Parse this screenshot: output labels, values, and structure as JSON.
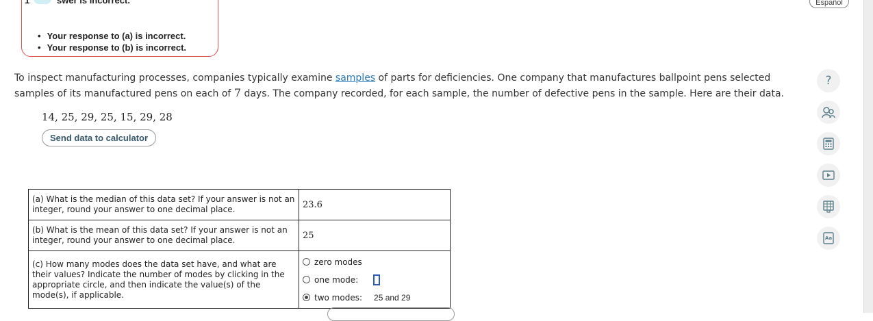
{
  "feedback": {
    "digit": "1",
    "title": "swer is incorrect.",
    "items": [
      "Your response to (a) is incorrect.",
      "Your response to (b) is incorrect."
    ]
  },
  "language_button": "Español",
  "problem": {
    "text_before_link": "To inspect manufacturing processes, companies typically examine ",
    "link": "samples",
    "text_after_link": " of parts for deficiencies. One company that manufactures ballpoint pens selected samples of its manufactured pens on each of ",
    "days": "7",
    "text_end": " days. The company recorded, for each sample, the number of defective pens in the sample. Here are their data."
  },
  "dataset": "14, 25, 29, 25, 15, 29, 28",
  "send_button": "Send data to calculator",
  "questions": {
    "a": {
      "text": "(a) What is the median of this data set? If your answer is not an integer, round your answer to one decimal place.",
      "answer": "23.6"
    },
    "b": {
      "text": "(b) What is the mean of this data set? If your answer is not an integer, round your answer to one decimal place.",
      "answer": "25"
    },
    "c": {
      "text": "(c) How many modes does the data set have, and what are their values? Indicate the number of modes by clicking in the appropriate circle, and then indicate the value(s) of the mode(s), if applicable.",
      "options": [
        "zero modes",
        "one mode:",
        "two modes:"
      ],
      "selected": "two modes:",
      "two_modes_value": "25 and 29"
    }
  },
  "tools": [
    "help-icon",
    "tutor-icon",
    "calculator-icon",
    "video-icon",
    "data-table-icon",
    "glossary-icon"
  ],
  "tool_glyphs": {
    "help": "?",
    "video": "▷",
    "glossary": "Aa"
  }
}
